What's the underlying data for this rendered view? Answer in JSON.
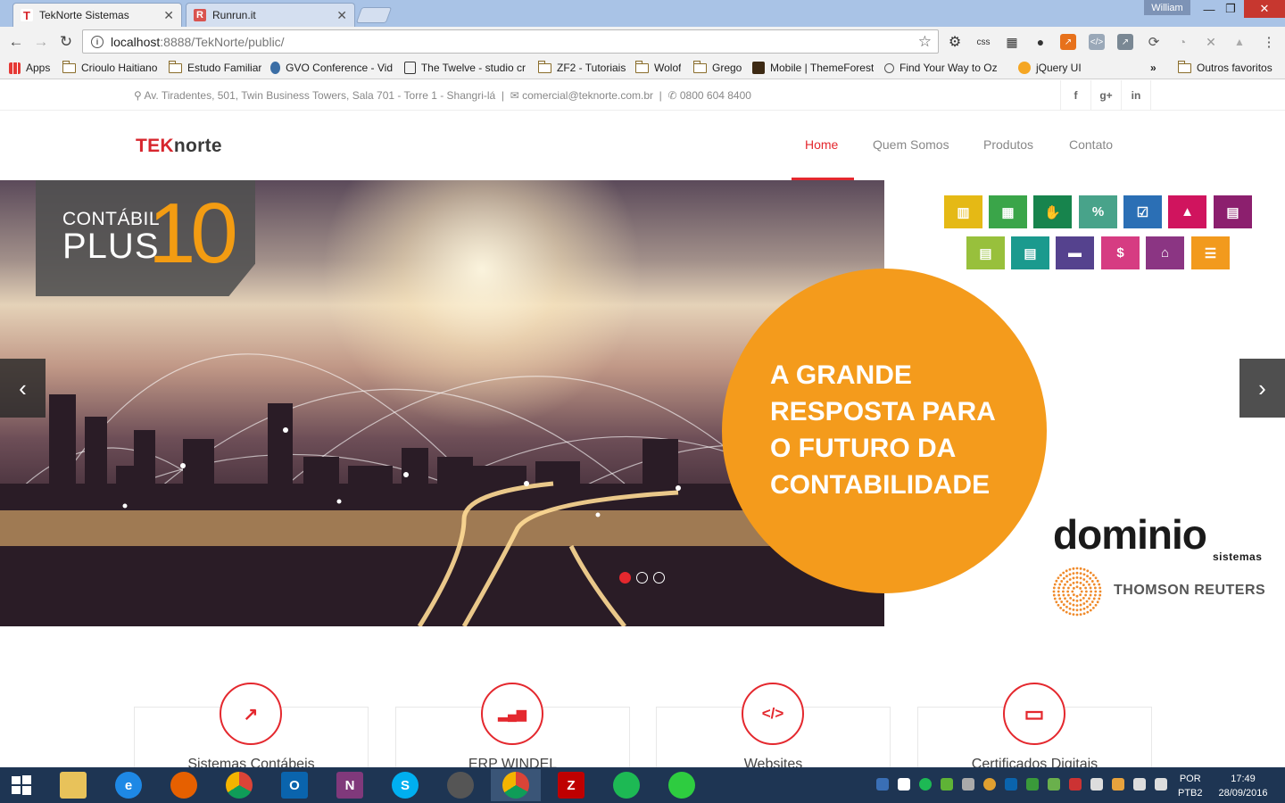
{
  "browser": {
    "tabs": [
      {
        "title": "TekNorte Sistemas",
        "favicon": "T"
      },
      {
        "title": "Runrun.it",
        "favicon": "R"
      }
    ],
    "user": "William",
    "url_host": "localhost",
    "url_rest": ":8888/TekNorte/public/",
    "bookmarks": [
      "Apps",
      "Crioulo Haitiano",
      "Estudo Familiar",
      "GVO Conference - Vid",
      "The Twelve - studio cr",
      "ZF2 - Tutoriais",
      "Wolof",
      "Grego",
      "Mobile | ThemeForest",
      "Find Your Way to Oz",
      "jQuery UI",
      "»",
      "Outros favoritos"
    ]
  },
  "site": {
    "address": "Av. Tiradentes, 501, Twin Business Towers, Sala 701 - Torre 1 - Shangri-lá",
    "email": "comercial@teknorte.com.br",
    "phone": "0800 604 8400",
    "social": [
      "f",
      "g+",
      "in"
    ],
    "logo_tek": "TEK",
    "logo_norte": "norte",
    "menu": [
      "Home",
      "Quem Somos",
      "Produtos",
      "Contato"
    ],
    "hero": {
      "badge_line1": "CONTÁBIL",
      "badge_line2": "PLUS",
      "badge_number": "10",
      "headline": [
        "A GRANDE",
        "RESPOSTA PARA",
        "O FUTURO DA",
        "CONTABILIDADE"
      ],
      "prev_arrow": "‹",
      "next_arrow": "›"
    },
    "icon_tiles": [
      {
        "icon": "bar-chart-icon",
        "color": "#e5b915",
        "glyph": "▥"
      },
      {
        "icon": "calculator-icon",
        "color": "#3aa549",
        "glyph": "▦"
      },
      {
        "icon": "hand-money-icon",
        "color": "#17844d",
        "glyph": "✋"
      },
      {
        "icon": "percent-icon",
        "color": "#48a38a",
        "glyph": "%"
      },
      {
        "icon": "checklist-icon",
        "color": "#2b6fb5",
        "glyph": "☑"
      },
      {
        "icon": "person-icon",
        "color": "#d0145e",
        "glyph": "▲"
      },
      {
        "icon": "book-icon",
        "color": "#8c1f6e",
        "glyph": "▤"
      },
      {
        "icon": "notebook-icon",
        "color": "#98c03c",
        "glyph": "▤"
      },
      {
        "icon": "document-icon",
        "color": "#1b9a8e",
        "glyph": "▤"
      },
      {
        "icon": "briefcase-icon",
        "color": "#55428e",
        "glyph": "▬"
      },
      {
        "icon": "dollar-icon",
        "color": "#d63c82",
        "glyph": "$"
      },
      {
        "icon": "house-icon",
        "color": "#8b3583",
        "glyph": "⌂"
      },
      {
        "icon": "list-icon",
        "color": "#f29a1d",
        "glyph": "☰"
      }
    ],
    "partner_dominio": "dominio",
    "partner_dominio_sub": "sistemas",
    "partner_thomson": "THOMSON REUTERS",
    "services": [
      {
        "title": "Sistemas Contábeis",
        "icon": "chart-up-icon",
        "glyph": "↗"
      },
      {
        "title": "ERP WINDEL",
        "icon": "signal-bars-icon",
        "glyph": "▂▄▆"
      },
      {
        "title": "Websites",
        "icon": "code-icon",
        "glyph": "</>"
      },
      {
        "title": "Certificados Digitais",
        "icon": "card-icon",
        "glyph": "▭"
      }
    ]
  },
  "taskbar": {
    "lang_line1": "POR",
    "lang_line2": "PTB2",
    "time": "17:49",
    "date": "28/09/2016"
  }
}
